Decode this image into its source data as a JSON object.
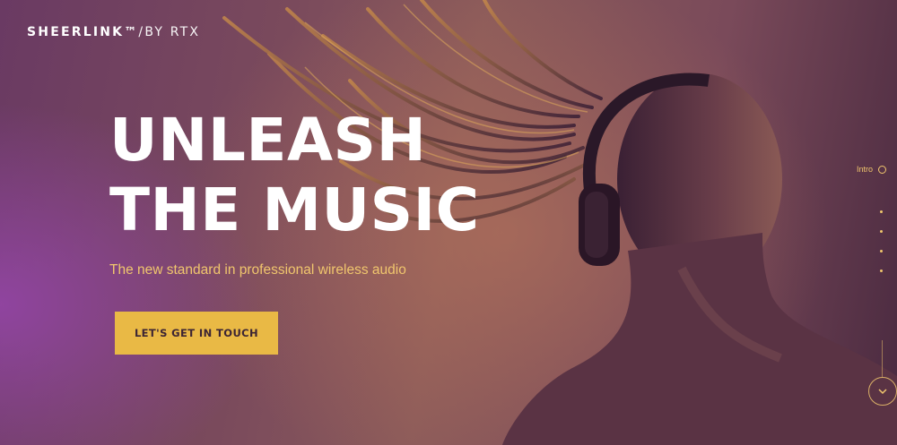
{
  "brand": {
    "name": "SHEERLINK™",
    "byline": "/BY RTX"
  },
  "hero": {
    "headline_line1": "UNLEASH",
    "headline_line2": "THE MUSIC",
    "subtitle": "The new standard in professional wireless audio",
    "cta_label": "LET'S GET IN TOUCH"
  },
  "side_nav": {
    "active_label": "Intro",
    "items_count_note": "",
    "icon": "ring-indicator-icon"
  },
  "scroll_button": {
    "icon": "chevron-down-icon"
  },
  "colors": {
    "accent": "#e9b945",
    "accent_text": "#f0c66d",
    "headline": "#ffffff",
    "cta_text": "#3c2534"
  }
}
